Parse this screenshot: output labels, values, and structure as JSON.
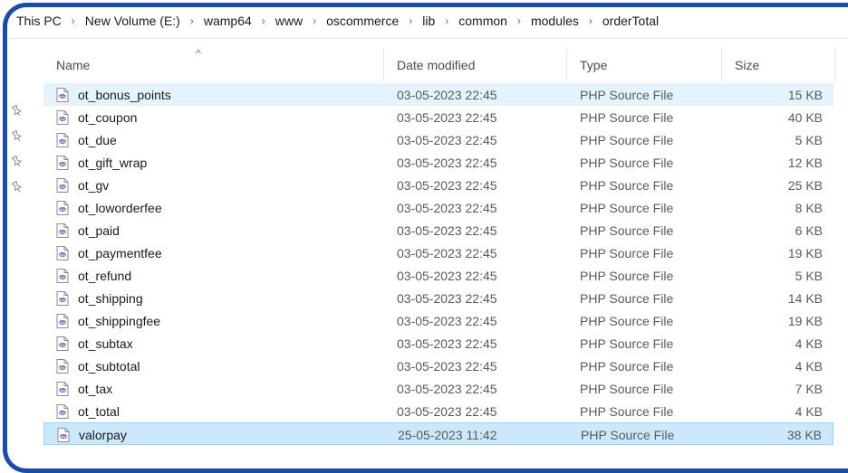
{
  "breadcrumb": [
    "This PC",
    "New Volume (E:)",
    "wamp64",
    "www",
    "oscommerce",
    "lib",
    "common",
    "modules",
    "orderTotal"
  ],
  "columns": {
    "name": "Name",
    "date": "Date modified",
    "type": "Type",
    "size": "Size"
  },
  "sort": {
    "column": "name",
    "indicator": "^"
  },
  "files": [
    {
      "name": "ot_bonus_points",
      "date": "03-05-2023 22:45",
      "type": "PHP Source File",
      "size": "15 KB",
      "state": "hover"
    },
    {
      "name": "ot_coupon",
      "date": "03-05-2023 22:45",
      "type": "PHP Source File",
      "size": "40 KB",
      "state": ""
    },
    {
      "name": "ot_due",
      "date": "03-05-2023 22:45",
      "type": "PHP Source File",
      "size": "5 KB",
      "state": ""
    },
    {
      "name": "ot_gift_wrap",
      "date": "03-05-2023 22:45",
      "type": "PHP Source File",
      "size": "12 KB",
      "state": ""
    },
    {
      "name": "ot_gv",
      "date": "03-05-2023 22:45",
      "type": "PHP Source File",
      "size": "25 KB",
      "state": ""
    },
    {
      "name": "ot_loworderfee",
      "date": "03-05-2023 22:45",
      "type": "PHP Source File",
      "size": "8 KB",
      "state": ""
    },
    {
      "name": "ot_paid",
      "date": "03-05-2023 22:45",
      "type": "PHP Source File",
      "size": "6 KB",
      "state": ""
    },
    {
      "name": "ot_paymentfee",
      "date": "03-05-2023 22:45",
      "type": "PHP Source File",
      "size": "19 KB",
      "state": ""
    },
    {
      "name": "ot_refund",
      "date": "03-05-2023 22:45",
      "type": "PHP Source File",
      "size": "5 KB",
      "state": ""
    },
    {
      "name": "ot_shipping",
      "date": "03-05-2023 22:45",
      "type": "PHP Source File",
      "size": "14 KB",
      "state": ""
    },
    {
      "name": "ot_shippingfee",
      "date": "03-05-2023 22:45",
      "type": "PHP Source File",
      "size": "19 KB",
      "state": ""
    },
    {
      "name": "ot_subtax",
      "date": "03-05-2023 22:45",
      "type": "PHP Source File",
      "size": "4 KB",
      "state": ""
    },
    {
      "name": "ot_subtotal",
      "date": "03-05-2023 22:45",
      "type": "PHP Source File",
      "size": "4 KB",
      "state": ""
    },
    {
      "name": "ot_tax",
      "date": "03-05-2023 22:45",
      "type": "PHP Source File",
      "size": "7 KB",
      "state": ""
    },
    {
      "name": "ot_total",
      "date": "03-05-2023 22:45",
      "type": "PHP Source File",
      "size": "4 KB",
      "state": ""
    },
    {
      "name": "valorpay",
      "date": "25-05-2023 11:42",
      "type": "PHP Source File",
      "size": "38 KB",
      "state": "selected"
    }
  ],
  "pinned_count": 4,
  "icons": {
    "file": "php-file-icon",
    "pin": "pin-icon",
    "separator": "chevron-right-icon"
  },
  "colors": {
    "frame": "#1a4da8",
    "hover": "#e5f3ff",
    "selected": "#cce8ff",
    "php_icon": "#8a76b8"
  }
}
